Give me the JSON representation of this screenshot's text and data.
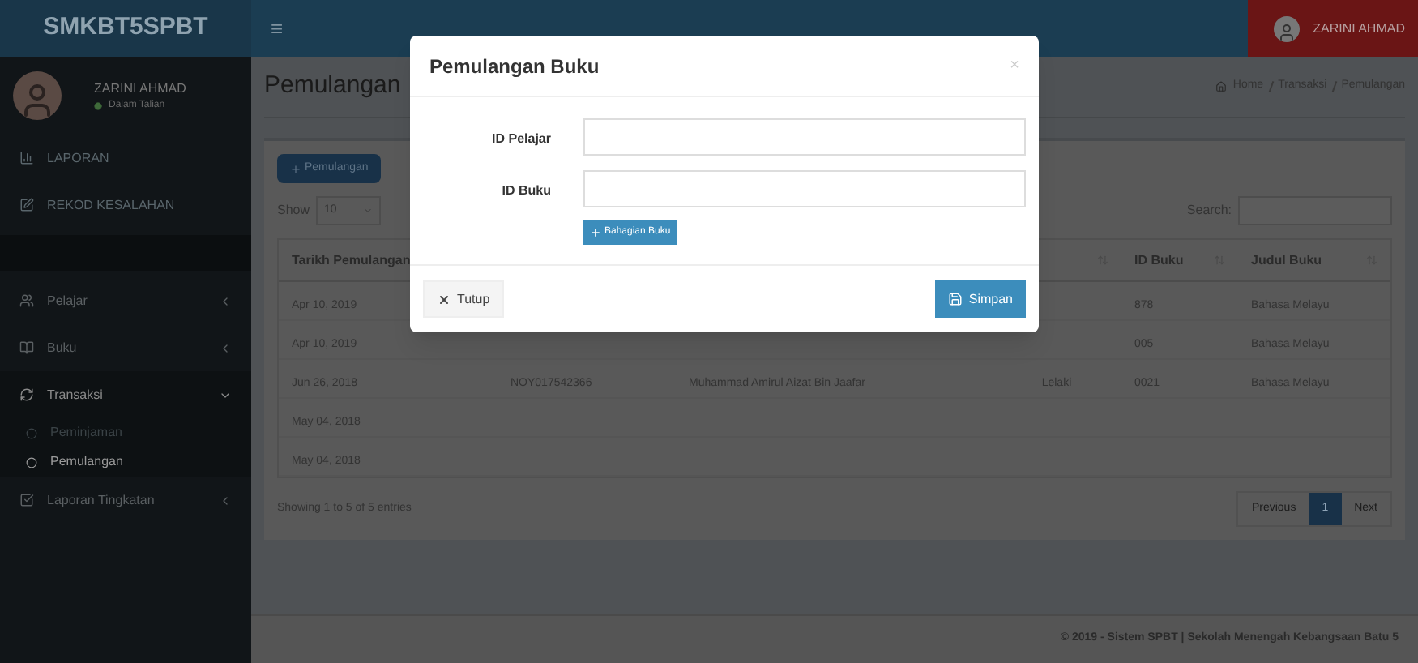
{
  "header": {
    "logo": "SMKBT5SPBT",
    "menu_toggle": "≡",
    "user": "ZARINI AHMAD"
  },
  "sidebar": {
    "user": {
      "name": "ZARINI AHMAD",
      "status": "Dalam Talian"
    },
    "items": [
      {
        "label": "LAPORAN",
        "kind": "link"
      },
      {
        "label": "REKOD KESALAHAN",
        "kind": "link"
      },
      {
        "kind": "section"
      },
      {
        "label": "Pelajar",
        "kind": "tree",
        "expanded": false
      },
      {
        "label": "Buku",
        "kind": "tree",
        "expanded": false
      },
      {
        "label": "Transaksi",
        "kind": "tree",
        "expanded": true,
        "children": [
          {
            "label": "Peminjaman",
            "selected": false
          },
          {
            "label": "Pemulangan",
            "selected": true
          }
        ]
      },
      {
        "label": "Laporan Tingkatan",
        "kind": "tree",
        "expanded": false
      }
    ]
  },
  "page": {
    "title": "Pemulangan",
    "breadcrumb": [
      "Home",
      "Transaksi",
      "Pemulangan"
    ]
  },
  "add_button": "Pemulangan",
  "length": {
    "label": "Show",
    "value": "10"
  },
  "search": {
    "label": "Search:"
  },
  "table": {
    "columns": [
      "Tarikh Pemulangan",
      null,
      null,
      null,
      "ID Buku",
      "Judul Buku"
    ],
    "rows": [
      [
        "Apr 10, 2019",
        null,
        null,
        null,
        "878",
        "Bahasa Melayu"
      ],
      [
        "Apr 10, 2019",
        null,
        null,
        null,
        "005",
        "Bahasa Melayu"
      ],
      [
        "Jun 26, 2018",
        "NOY017542366",
        "Muhammad Amirul Aizat Bin Jaafar",
        "Lelaki",
        "0021",
        "Bahasa Melayu"
      ],
      [
        "May 04, 2018",
        null,
        null,
        null,
        null,
        null
      ],
      [
        "May 04, 2018",
        null,
        null,
        null,
        null,
        null
      ]
    ]
  },
  "info": "Showing 1 to 5 of 5 entries",
  "pagination": [
    {
      "label": "Previous",
      "selected": false
    },
    {
      "label": "1",
      "selected": true
    },
    {
      "label": "Next",
      "selected": false
    }
  ],
  "footer": "© 2019 - Sistem SPBT | Sekolah Menengah Kebangsaan Batu 5",
  "modal": {
    "title": "Pemulangan Buku",
    "close": "×",
    "fields": [
      {
        "label": "ID Pelajar"
      },
      {
        "label": "ID Buku"
      }
    ],
    "add_button": "Bahagian Buku",
    "buttons": [
      {
        "label": "Tutup",
        "kind": "close"
      },
      {
        "label": "Simpan",
        "kind": "save"
      }
    ]
  }
}
